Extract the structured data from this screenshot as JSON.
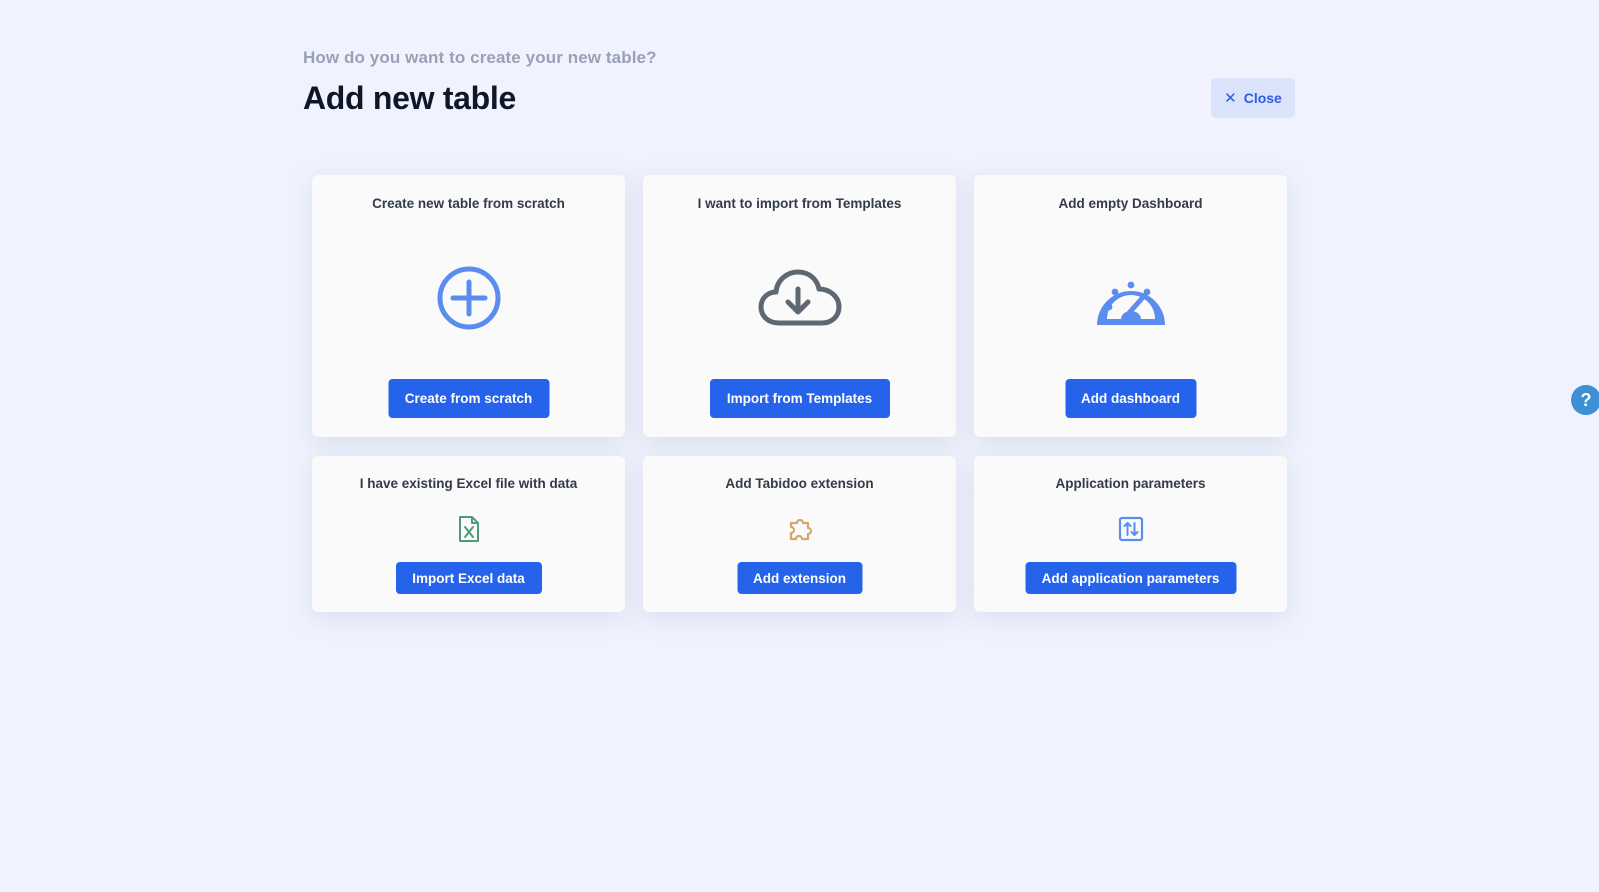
{
  "header": {
    "subtitle": "How do you want to create your new table?",
    "title": "Add new table",
    "close_label": "Close"
  },
  "cards": [
    {
      "title": "Create new table from scratch",
      "button": "Create from scratch",
      "icon": "plus-circle-icon"
    },
    {
      "title": "I want to import from Templates",
      "button": "Import from Templates",
      "icon": "cloud-download-icon"
    },
    {
      "title": "Add empty Dashboard",
      "button": "Add dashboard",
      "icon": "gauge-icon"
    },
    {
      "title": "I have existing Excel file with data",
      "button": "Import Excel data",
      "icon": "excel-file-icon"
    },
    {
      "title": "Add Tabidoo extension",
      "button": "Add extension",
      "icon": "puzzle-icon"
    },
    {
      "title": "Application parameters",
      "button": "Add application parameters",
      "icon": "parameters-icon"
    }
  ],
  "help_label": "?",
  "colors": {
    "background": "#f0f3fd",
    "primary": "#2563eb",
    "icon_blue": "#5b8def",
    "icon_gray": "#5f6772",
    "icon_green": "#4f9a7a",
    "icon_tan": "#d3a86a"
  }
}
